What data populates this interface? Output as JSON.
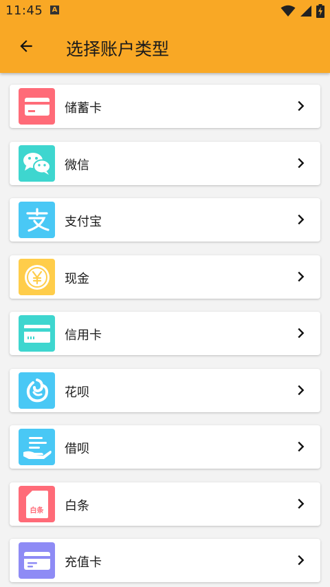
{
  "status_bar": {
    "time": "11:45",
    "notification_icon": "A"
  },
  "toolbar": {
    "title": "选择账户类型",
    "back_icon": "arrow-left-icon"
  },
  "colors": {
    "appbar": "#F9A825",
    "debit_card": "#FF6B78",
    "wechat": "#3ED6CF",
    "alipay": "#49C8F5",
    "cash": "#FFCD4A",
    "credit_card": "#3ED6CF",
    "huabei": "#49C8F5",
    "jiebei": "#49C8F5",
    "baitiao": "#FF6B78",
    "prepaid_card": "#8E8BF5"
  },
  "accounts": [
    {
      "label": "储蓄卡",
      "icon": "debit-card-icon"
    },
    {
      "label": "微信",
      "icon": "wechat-icon"
    },
    {
      "label": "支付宝",
      "icon": "alipay-icon"
    },
    {
      "label": "现金",
      "icon": "cash-coin-icon"
    },
    {
      "label": "信用卡",
      "icon": "credit-card-icon"
    },
    {
      "label": "花呗",
      "icon": "huabei-icon"
    },
    {
      "label": "借呗",
      "icon": "jiebei-icon"
    },
    {
      "label": "白条",
      "icon": "baitiao-icon",
      "icon_text": "白条"
    },
    {
      "label": "充值卡",
      "icon": "prepaid-card-icon"
    }
  ]
}
